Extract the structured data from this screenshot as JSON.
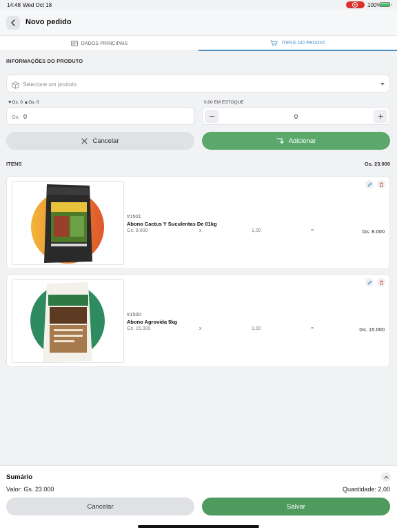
{
  "status_bar": {
    "time": "14:48",
    "date": "Wed Oct 18",
    "battery": "100%"
  },
  "header": {
    "title": "Novo pedido"
  },
  "tabs": [
    {
      "label": "DADOS PRINCIPAIS",
      "icon": "id-card-icon",
      "active": false
    },
    {
      "label": "ITENS DO PEDIDO",
      "icon": "cart-icon",
      "active": true
    }
  ],
  "product_info": {
    "section_title": "INFORMAÇÕES DO PRODUTO",
    "select_placeholder": "Selecione um produto",
    "price_hint": "▼Gs. 0 ▲Gs. 0",
    "price_currency": "Gs.",
    "price_value": "0",
    "stock_label": "0,00 EM ESTOQUE",
    "quantity": "0",
    "cancel_label": "Cancelar",
    "add_label": "Adicionar"
  },
  "items": {
    "section_title": "ITENS",
    "total": "Gs. 23.000",
    "list": [
      {
        "code": "#1501",
        "name": "Abono Cactus Y Suculentas De 01kg",
        "unit_price": "Gs. 8.000",
        "times": "x",
        "qty": "1,00",
        "eq": "=",
        "subtotal": "Gs. 8.000"
      },
      {
        "code": "#1500",
        "name": "Abono Agrovida 5kg",
        "unit_price": "Gs. 15.000",
        "times": "x",
        "qty": "1,00",
        "eq": "=",
        "subtotal": "Gs. 15.000"
      }
    ]
  },
  "summary": {
    "title": "Sumário",
    "valor": "Valor: Gs. 23.000",
    "quantidade": "Quantidade: 2,00",
    "cancel_label": "Cancelar",
    "save_label": "Salvar"
  },
  "colors": {
    "accent_green": "#5aa86a",
    "accent_blue": "#4a90c8",
    "delete_red": "#d9534f"
  }
}
